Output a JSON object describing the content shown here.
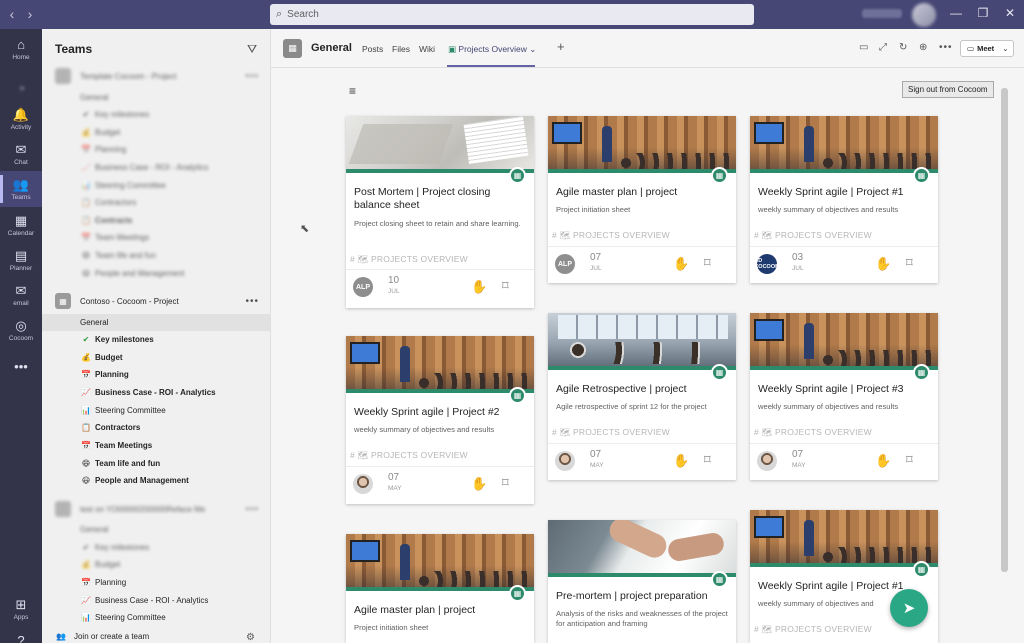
{
  "titlebar": {
    "search_placeholder": "Search",
    "back_icon": "‹",
    "forward_icon": "›",
    "minimize_icon": "—",
    "restore_icon": "❐",
    "close_icon": "✕"
  },
  "rail": [
    {
      "label": "Home",
      "icon": "⌂"
    },
    {
      "label": "",
      "icon": "◔"
    },
    {
      "label": "Activity",
      "icon": "🔔"
    },
    {
      "label": "Chat",
      "icon": "✉"
    },
    {
      "label": "Teams",
      "icon": "👥"
    },
    {
      "label": "Calendar",
      "icon": "▦"
    },
    {
      "label": "Planner",
      "icon": "▤"
    },
    {
      "label": "email",
      "icon": "✉"
    },
    {
      "label": "Cocoom",
      "icon": "◎"
    },
    {
      "label": "",
      "icon": "•••"
    },
    {
      "label": "Apps",
      "icon": "⊞"
    },
    {
      "label": "",
      "icon": "?"
    }
  ],
  "teams_panel": {
    "title": "Teams",
    "team1": {
      "name": "Template Cocoom - Project",
      "channels": [
        "General",
        "Key milestones",
        "Budget",
        "Planning",
        "Business Case - ROI - Analytics",
        "Steering Committee",
        "Contractors",
        "Contracts",
        "Team Meetings",
        "Team life and fun",
        "People and Management"
      ]
    },
    "team2": {
      "name": "Contoso - Cocoom - Project",
      "channels": [
        {
          "label": "General",
          "emoji": ""
        },
        {
          "label": "Key milestones",
          "emoji": "✔"
        },
        {
          "label": "Budget",
          "emoji": "💰"
        },
        {
          "label": "Planning",
          "emoji": "📅"
        },
        {
          "label": "Business Case - ROI - Analytics",
          "emoji": "📈"
        },
        {
          "label": "Steering Committee",
          "emoji": "📊"
        },
        {
          "label": "Contractors",
          "emoji": "📋"
        },
        {
          "label": "Team Meetings",
          "emoji": "📅"
        },
        {
          "label": "Team life and fun",
          "emoji": "😄"
        },
        {
          "label": "People and Management",
          "emoji": "😃"
        }
      ]
    },
    "team3": {
      "name": "test on YO00000200000Reface Me",
      "channels": [
        "General",
        "Key milestones",
        "Budget",
        "Planning",
        "Business Case - ROI - Analytics",
        "Steering Committee"
      ]
    },
    "join_label": "Join or create a team"
  },
  "channel_header": {
    "name": "General",
    "tabs": [
      "Posts",
      "Files",
      "Wiki",
      "Projects Overview"
    ],
    "meet_label": "Meet"
  },
  "content": {
    "signout_label": "Sign out from Cocoom"
  },
  "cards": [
    {
      "title": "Post Mortem | Project closing balance sheet",
      "desc": "Project closing sheet to retain and share learning.",
      "tag": "# 🗺 PROJECTS OVERVIEW",
      "avatar": "ALP",
      "day": "10",
      "month": "JUL"
    },
    {
      "title": "Agile master plan | project",
      "desc": "Project initiation sheet",
      "tag": "# 🗺 PROJECTS OVERVIEW",
      "avatar": "ALP",
      "day": "07",
      "month": "JUL"
    },
    {
      "title": "Weekly Sprint agile  | Project #1",
      "desc": "weekly summary of objectives and results",
      "tag": "# 🗺 PROJECTS OVERVIEW",
      "avatar": "CD COCOOM",
      "day": "03",
      "month": "JUL"
    },
    {
      "title": "Weekly Sprint agile  | Project #2",
      "desc": "weekly summary of objectives and results",
      "tag": "# 🗺 PROJECTS OVERVIEW",
      "avatar": "",
      "day": "07",
      "month": "MAY"
    },
    {
      "title": "Agile Retrospective | project",
      "desc": "Agile retrospective of sprint 12 for the project",
      "tag": "# 🗺 PROJECTS OVERVIEW",
      "avatar": "",
      "day": "07",
      "month": "MAY"
    },
    {
      "title": "Weekly Sprint agile  | Project #3",
      "desc": "weekly summary of objectives and results",
      "tag": "# 🗺 PROJECTS OVERVIEW",
      "avatar": "",
      "day": "07",
      "month": "MAY"
    },
    {
      "title": "Agile master plan | project",
      "desc": "Project initiation sheet"
    },
    {
      "title": "Pre-mortem | project preparation",
      "desc": "Analysis of the risks and weaknesses of the project for anticipation and framing"
    },
    {
      "title": "Weekly Sprint agile  | Project #1",
      "desc": "weekly summary of objectives and",
      "tag": "# 🗺 PROJECTS OVERVIEW"
    }
  ]
}
